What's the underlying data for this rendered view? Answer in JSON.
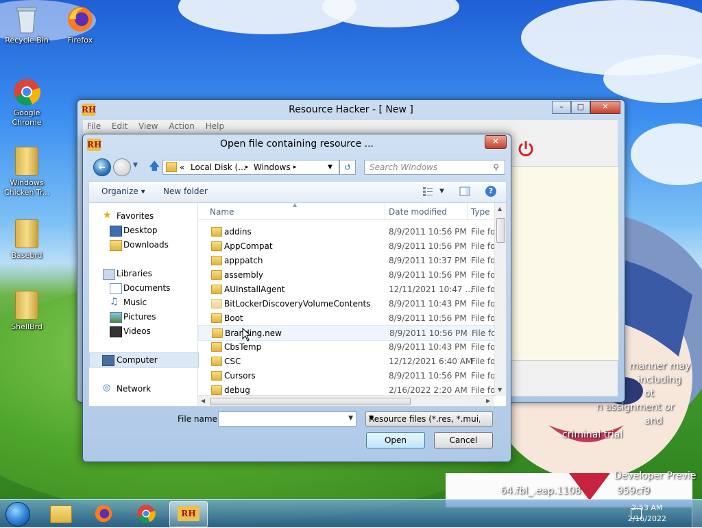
{
  "desktop": {
    "icons": [
      {
        "label": "Recycle Bin"
      },
      {
        "label": "Firefox"
      },
      {
        "label": "Google Chrome"
      },
      {
        "label": "Windows Chicken Tr..."
      },
      {
        "label": "Basebrd"
      },
      {
        "label": "ShellBrd"
      }
    ],
    "overlay_lines": [
      "manner may",
      "including",
      "ot",
      "n assignment or",
      "and",
      "criminal trial",
      "Developer Previe",
      "64.fbl_.eap.1108",
      "959cf9"
    ]
  },
  "taskbar": {
    "clock_time": "2:53 AM",
    "clock_date": "2/16/2022"
  },
  "rh_window": {
    "title": "Resource Hacker - [ New ]",
    "logo": "RH",
    "menu": [
      "File",
      "Edit",
      "View",
      "Action",
      "Help"
    ]
  },
  "dialog": {
    "title": "Open file containing resource ...",
    "breadcrumb": {
      "prefix": "«",
      "part1": "Local Disk (...",
      "sep1": "▸",
      "part2": "Windows",
      "sep2": "▸"
    },
    "search_placeholder": "Search Windows",
    "toolbar": {
      "organize": "Organize ▾",
      "new_folder": "New folder"
    },
    "nav": {
      "favorites": "Favorites",
      "desktop": "Desktop",
      "downloads": "Downloads",
      "libraries": "Libraries",
      "documents": "Documents",
      "music": "Music",
      "pictures": "Pictures",
      "videos": "Videos",
      "computer": "Computer",
      "network": "Network"
    },
    "columns": {
      "name": "Name",
      "date": "Date modified",
      "type": "Type"
    },
    "files": [
      {
        "name": "addins",
        "date": "8/9/2011 10:56 PM",
        "type": "File fol"
      },
      {
        "name": "AppCompat",
        "date": "8/9/2011 10:56 PM",
        "type": "File fol"
      },
      {
        "name": "apppatch",
        "date": "8/9/2011 10:37 PM",
        "type": "File fol"
      },
      {
        "name": "assembly",
        "date": "8/9/2011 10:56 PM",
        "type": "File fol"
      },
      {
        "name": "AUInstallAgent",
        "date": "12/11/2021 10:47 ...",
        "type": "File fol"
      },
      {
        "name": "BitLockerDiscoveryVolumeContents",
        "date": "8/9/2011 10:43 PM",
        "type": "File fol"
      },
      {
        "name": "Boot",
        "date": "8/9/2011 10:56 PM",
        "type": "File fol"
      },
      {
        "name": "Branding.new",
        "date": "8/9/2011 10:56 PM",
        "type": "File fol"
      },
      {
        "name": "CbsTemp",
        "date": "8/9/2011 10:43 PM",
        "type": "File fol"
      },
      {
        "name": "CSC",
        "date": "12/12/2021 6:40 AM",
        "type": "File fol"
      },
      {
        "name": "Cursors",
        "date": "8/9/2011 10:56 PM",
        "type": "File fol"
      },
      {
        "name": "debug",
        "date": "2/16/2022 2:20 AM",
        "type": "File fol"
      }
    ],
    "file_name_label": "File name:",
    "file_name_value": "",
    "filter": "Resource files (*.res, *.mui, *.dll",
    "open_label": "Open",
    "cancel_label": "Cancel"
  }
}
